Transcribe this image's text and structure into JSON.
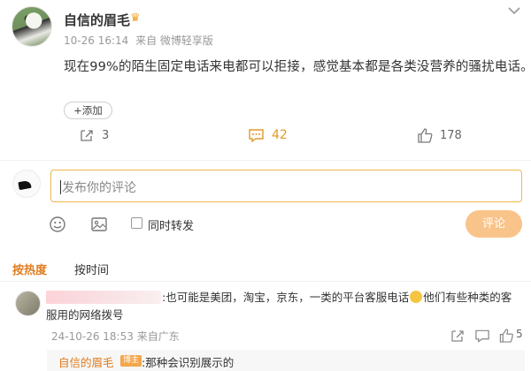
{
  "post": {
    "username": "自信的眉毛",
    "crown_icon": "crown-icon",
    "timestamp": "10-26 16:14",
    "source": "来自 微博轻享版",
    "text": "现在99%的陌生固定电话来电都可以拒接，感觉基本都是各类没营养的骚扰电话。",
    "add_tag_label": "+添加",
    "share_count": "3",
    "comment_count": "42",
    "like_count": "178"
  },
  "composer": {
    "placeholder": "发布你的评论",
    "repost_label": "同时转发",
    "submit_label": "评论"
  },
  "sort": {
    "hot_label": "按热度",
    "time_label": "按时间"
  },
  "comment": {
    "text_part1": ":也可能是美团，淘宝，京东，一类的平台客服电话",
    "text_part2": "他们有些种类的客",
    "text_line2": "服用的网络拨号",
    "timestamp": "24-10-26 18:53",
    "location": "来自广东",
    "like_count": "5"
  },
  "reply": {
    "username": "自信的眉毛",
    "badge": "博主",
    "text": ":那种会识别展示的"
  },
  "colors": {
    "accent": "#e07c1f",
    "comment_border": "#f0b64b",
    "submit_bg": "#f9c48a"
  }
}
